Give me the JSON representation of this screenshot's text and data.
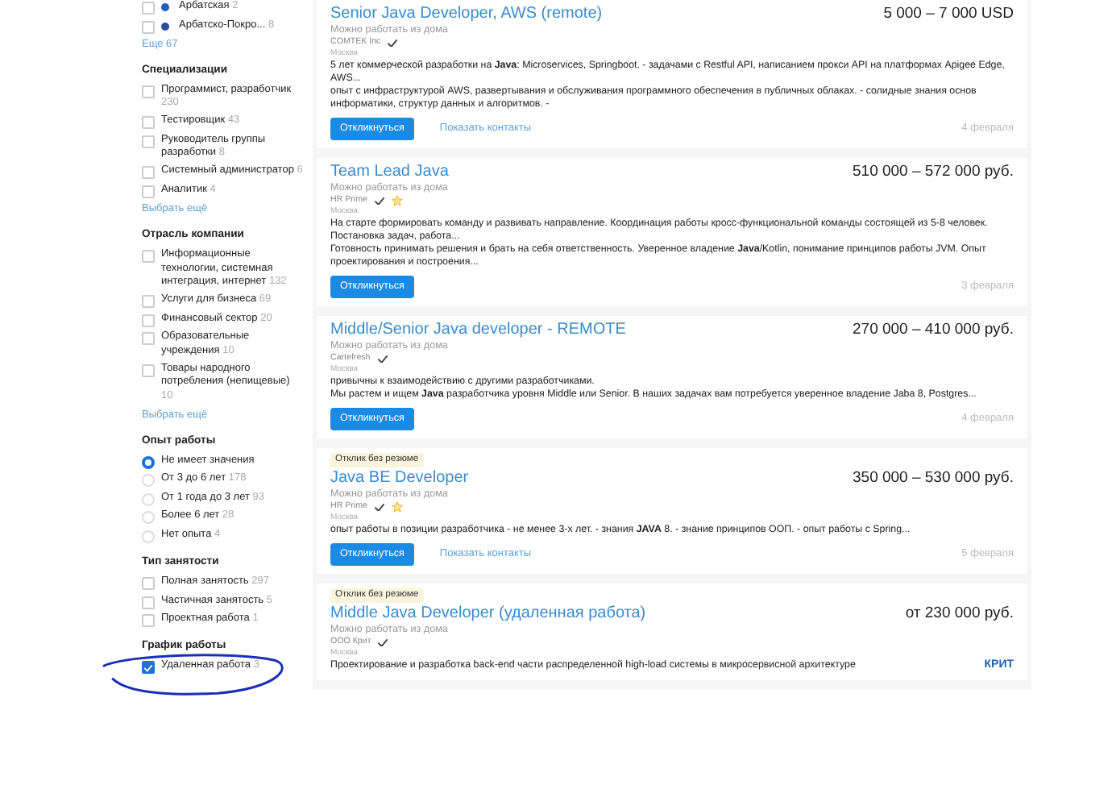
{
  "sidebar": {
    "sections": [
      {
        "kind": "metro",
        "items": [
          {
            "label": "Арбатская",
            "count": "2",
            "checked": false,
            "color": "#1f5fbf"
          },
          {
            "label": "Арбатско-Покро...",
            "count": "8",
            "checked": false,
            "color": "#2a4fa0"
          }
        ],
        "more_link": "Еще 67"
      },
      {
        "title": "Специализации",
        "kind": "checkbox",
        "items": [
          {
            "label": "Программист, разработчик",
            "count": "230",
            "checked": false
          },
          {
            "label": "Тестировщик",
            "count": "43",
            "checked": false
          },
          {
            "label": "Руководитель группы разработки",
            "count": "8",
            "checked": false
          },
          {
            "label": "Системный администратор",
            "count": "6",
            "checked": false
          },
          {
            "label": "Аналитик",
            "count": "4",
            "checked": false
          }
        ],
        "more_link": "Выбрать ещё"
      },
      {
        "title": "Отрасль компании",
        "kind": "checkbox",
        "items": [
          {
            "label": "Информационные технологии, системная интеграция, интернет",
            "count": "132",
            "checked": false
          },
          {
            "label": "Услуги для бизнеса",
            "count": "69",
            "checked": false
          },
          {
            "label": "Финансовый сектор",
            "count": "20",
            "checked": false
          },
          {
            "label": "Образовательные учреждения",
            "count": "10",
            "checked": false
          },
          {
            "label": "Товары народного потребления (непищевые)",
            "count": "10",
            "checked": false
          }
        ],
        "more_link": "Выбрать ещё"
      },
      {
        "title": "Опыт работы",
        "kind": "radio",
        "items": [
          {
            "label": "Не имеет значения",
            "selected": true
          },
          {
            "label": "От 3 до 6 лет",
            "count": "178",
            "selected": false
          },
          {
            "label": "От 1 года до 3 лет",
            "count": "93",
            "selected": false
          },
          {
            "label": "Более 6 лет",
            "count": "28",
            "selected": false
          },
          {
            "label": "Нет опыта",
            "count": "4",
            "selected": false
          }
        ]
      },
      {
        "title": "Тип занятости",
        "kind": "checkbox",
        "items": [
          {
            "label": "Полная занятость",
            "count": "297",
            "checked": false
          },
          {
            "label": "Частичная занятость",
            "count": "5",
            "checked": false
          },
          {
            "label": "Проектная работа",
            "count": "1",
            "checked": false
          }
        ]
      },
      {
        "title": "График работы",
        "kind": "checkbox",
        "items": [
          {
            "label": "Удаленная работа",
            "count": "3",
            "checked": true,
            "circled": true
          }
        ]
      }
    ]
  },
  "vacancies": [
    {
      "title": "Senior Java Developer, AWS (remote)",
      "salary": "5 000 – 7 000 USD",
      "remote": "Можно работать из дома",
      "company": "COMTEK Inc",
      "verified": true,
      "city": "Москва",
      "description": [
        "5 лет коммерческой разработки на **Java**: Microservices, Springboot. - задачами с Restful API, написанием прокси API на платформах Apigee Edge, AWS...",
        "опыт с инфраструктурой AWS, развертывания и обслуживания программного обеспечения в публичных облаках. - солидные знания основ информатики, структур данных и алгоритмов. -"
      ],
      "respond_button": "Откликнуться",
      "contacts_link": "Показать контакты",
      "date": "4 февраля"
    },
    {
      "title": "Team Lead Java",
      "salary": "510 000 – 572 000 руб.",
      "remote": "Можно работать из дома",
      "company": "HR Prime",
      "verified": true,
      "rated": true,
      "city": "Москва",
      "description": [
        "На старте формировать команду и развивать направление. Координация работы кросс-функциональной команды состоящей из 5-8 человек. Постановка задач, работа...",
        "Готовность принимать решения и брать на себя ответственность. Уверенное владение **Java**/Kotlin, понимание принципов работы JVM. Опыт проектирования и построения..."
      ],
      "respond_button": "Откликнуться",
      "date": "3 февраля"
    },
    {
      "title": "Middle/Senior Java developer - REMOTE",
      "salary": "270 000 – 410 000 руб.",
      "remote": "Можно работать из дома",
      "company": "Cartefresh",
      "verified": true,
      "city": "Москва",
      "description": [
        "привычны к взаимодействию с другими разработчиками.",
        "Мы растем и ищем **Java** разработчика уровня Middle или Senior. В наших задачах вам потребуется уверенное владение Jaba 8, Postgres..."
      ],
      "respond_button": "Откликнуться",
      "date": "4 февраля"
    },
    {
      "badge": "Отклик без резюме",
      "title": "Java BE Developer",
      "salary": "350 000 – 530 000 руб.",
      "remote": "Можно работать из дома",
      "company": "HR Prime",
      "verified": true,
      "rated": true,
      "city": "Москва",
      "description": [
        "опыт работы в позиции разработчика - не менее 3-х лет. - знания **JAVA** 8. - знание принципов ООП. - опыт работы с Spring..."
      ],
      "respond_button": "Откликнуться",
      "contacts_link": "Показать контакты",
      "date": "5 февраля"
    },
    {
      "badge": "Отклик без резюме",
      "title": "Middle Java Developer (удаленная работа)",
      "salary": "от 230 000 руб.",
      "remote": "Можно работать из дома",
      "company": "ООО Крит",
      "verified": true,
      "city": "Москва",
      "description": [
        "Проектирование и разработка back-end части распределенной high-load системы в микросервисной архитектуре"
      ],
      "logo_text": "КРИТ"
    }
  ]
}
